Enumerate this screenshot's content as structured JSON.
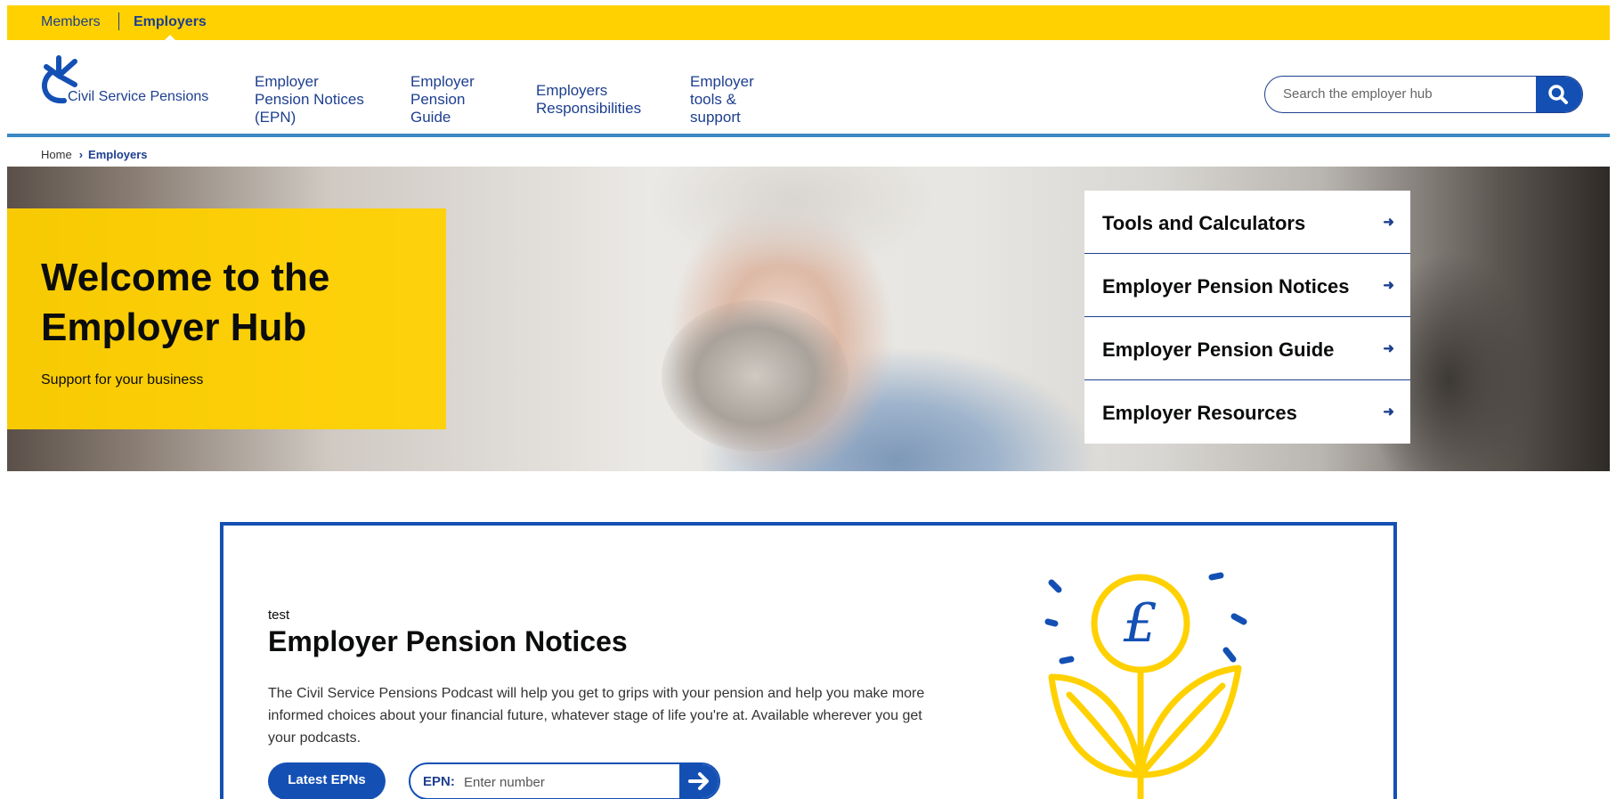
{
  "colors": {
    "brand_yellow": "#ffd100",
    "brand_blue": "#1450b4",
    "navy": "#1d3f8f",
    "rule_blue": "#3a88c4"
  },
  "audience": {
    "members": "Members",
    "employers": "Employers"
  },
  "logo": {
    "text": "Civil Service Pensions",
    "icon": "csp-logo-icon"
  },
  "nav": [
    {
      "label": "Employer Pension Notices (EPN)"
    },
    {
      "label": "Employer Pension Guide"
    },
    {
      "label": "Employers Responsibilities"
    },
    {
      "label": "Employer tools & support"
    }
  ],
  "search": {
    "placeholder": "Search the employer hub",
    "icon": "search-icon"
  },
  "breadcrumb": {
    "home": "Home",
    "current": "Employers"
  },
  "hero": {
    "title": "Welcome to the\nEmployer Hub",
    "subtitle": "Support for your business",
    "quick_links": [
      {
        "label": "Tools and Calculators"
      },
      {
        "label": "Employer Pension Notices"
      },
      {
        "label": "Employer Pension Guide"
      },
      {
        "label": "Employer Resources"
      }
    ]
  },
  "feature": {
    "eyebrow": "test",
    "title": "Employer Pension Notices",
    "body": "The Civil Service Pensions Podcast will help you get to grips with your pension and help you make more informed choices about your financial future, whatever stage of life you're at. Available wherever you get your podcasts.",
    "button_label": "Latest EPNs",
    "epn_prefix": "EPN:",
    "epn_placeholder": "Enter number",
    "illustration_icon": "pound-coin-plant-icon",
    "illustration_symbol": "£"
  }
}
